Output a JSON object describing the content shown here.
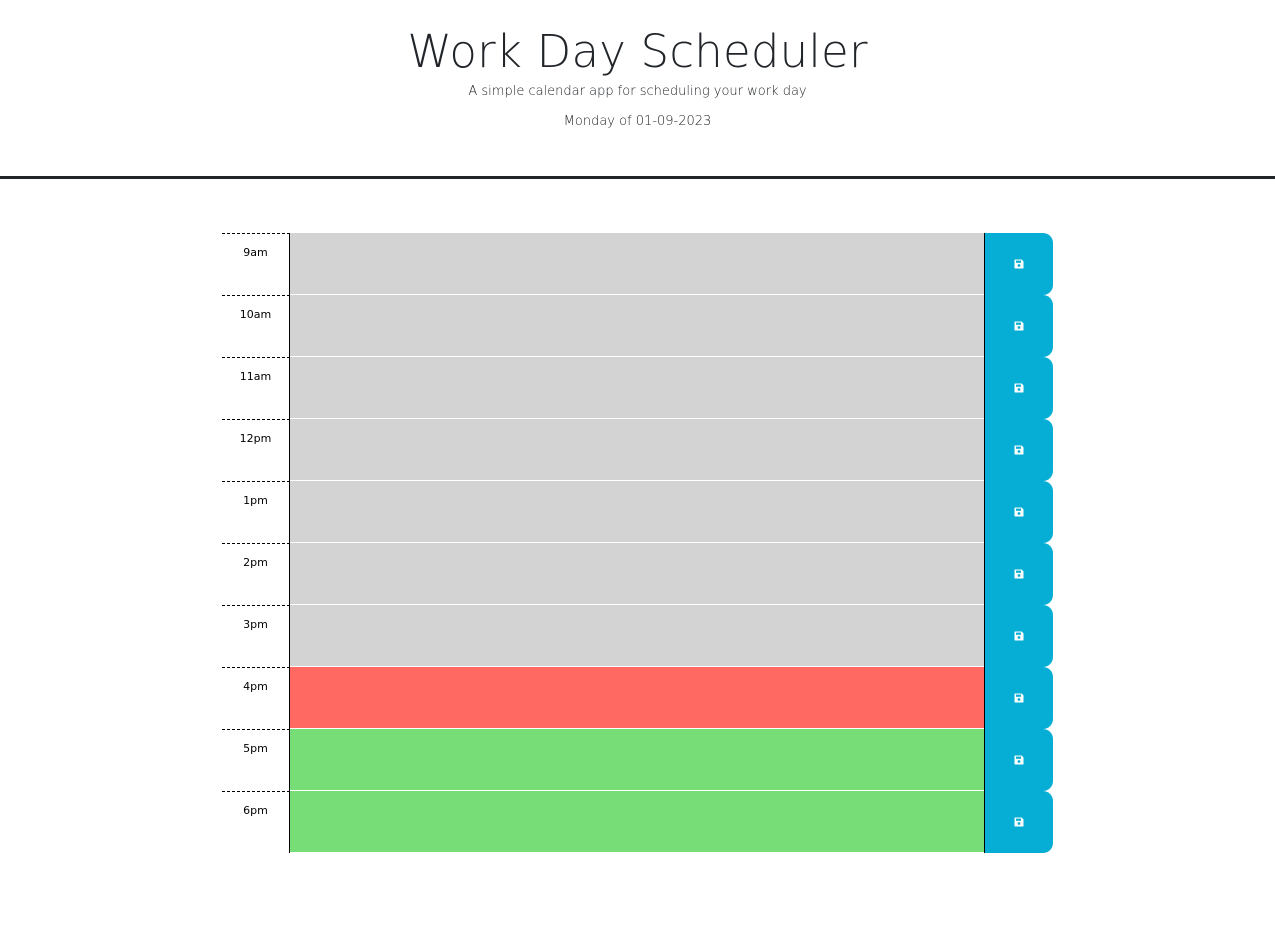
{
  "header": {
    "title": "Work Day Scheduler",
    "subtitle": "A simple calendar app for scheduling your work day",
    "current_day": "Monday of 01-09-2023"
  },
  "colors": {
    "past": "#d3d3d3",
    "present": "#ff6961",
    "future": "#77dd77",
    "save_button": "#06aed5"
  },
  "save_icon": "floppy-disk-icon",
  "time_blocks": [
    {
      "hour": "9am",
      "state": "past",
      "text": ""
    },
    {
      "hour": "10am",
      "state": "past",
      "text": ""
    },
    {
      "hour": "11am",
      "state": "past",
      "text": ""
    },
    {
      "hour": "12pm",
      "state": "past",
      "text": ""
    },
    {
      "hour": "1pm",
      "state": "past",
      "text": ""
    },
    {
      "hour": "2pm",
      "state": "past",
      "text": ""
    },
    {
      "hour": "3pm",
      "state": "past",
      "text": ""
    },
    {
      "hour": "4pm",
      "state": "present",
      "text": ""
    },
    {
      "hour": "5pm",
      "state": "future",
      "text": ""
    },
    {
      "hour": "6pm",
      "state": "future",
      "text": ""
    }
  ]
}
